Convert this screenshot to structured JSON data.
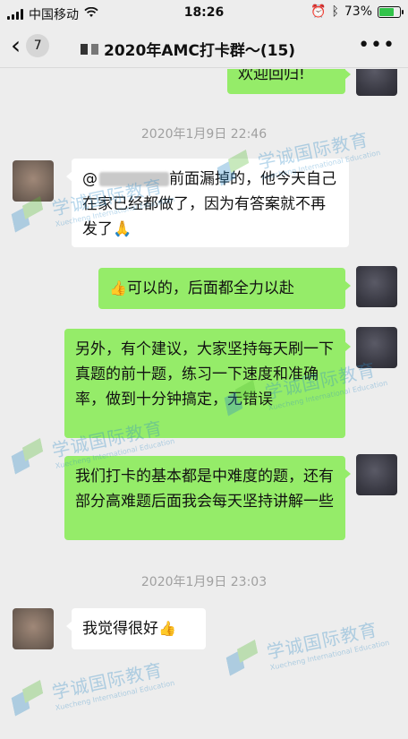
{
  "status_bar": {
    "carrier": "中国移动",
    "time": "18:26",
    "battery": "73%",
    "battery_level": 0.73
  },
  "header": {
    "back_count": "7",
    "title": "2020年AMC打卡群～(15)"
  },
  "messages": {
    "m0": {
      "text": "欢迎回归!"
    },
    "ts1": "2020年1月9日 22:46",
    "m1": {
      "mention": "@",
      "text": "前面漏掉的，他今天自己在家已经都做了，因为有答案就不再发了🙏"
    },
    "m2": {
      "emoji": "👍",
      "text": "可以的，后面都全力以赴"
    },
    "m3": {
      "text": "另外，有个建议，大家坚持每天刷一下真题的前十题，练习一下速度和准确率，做到十分钟搞定，无错误"
    },
    "m4": {
      "text": "我们打卡的基本都是中难度的题，还有部分高难题后面我会每天坚持讲解一些"
    },
    "ts2": "2020年1月9日 23:03",
    "m5": {
      "text": "我觉得很好",
      "emoji": "👍"
    }
  },
  "watermark": {
    "name": "学诚国际教育",
    "subtitle": "Xuecheng International Education"
  }
}
